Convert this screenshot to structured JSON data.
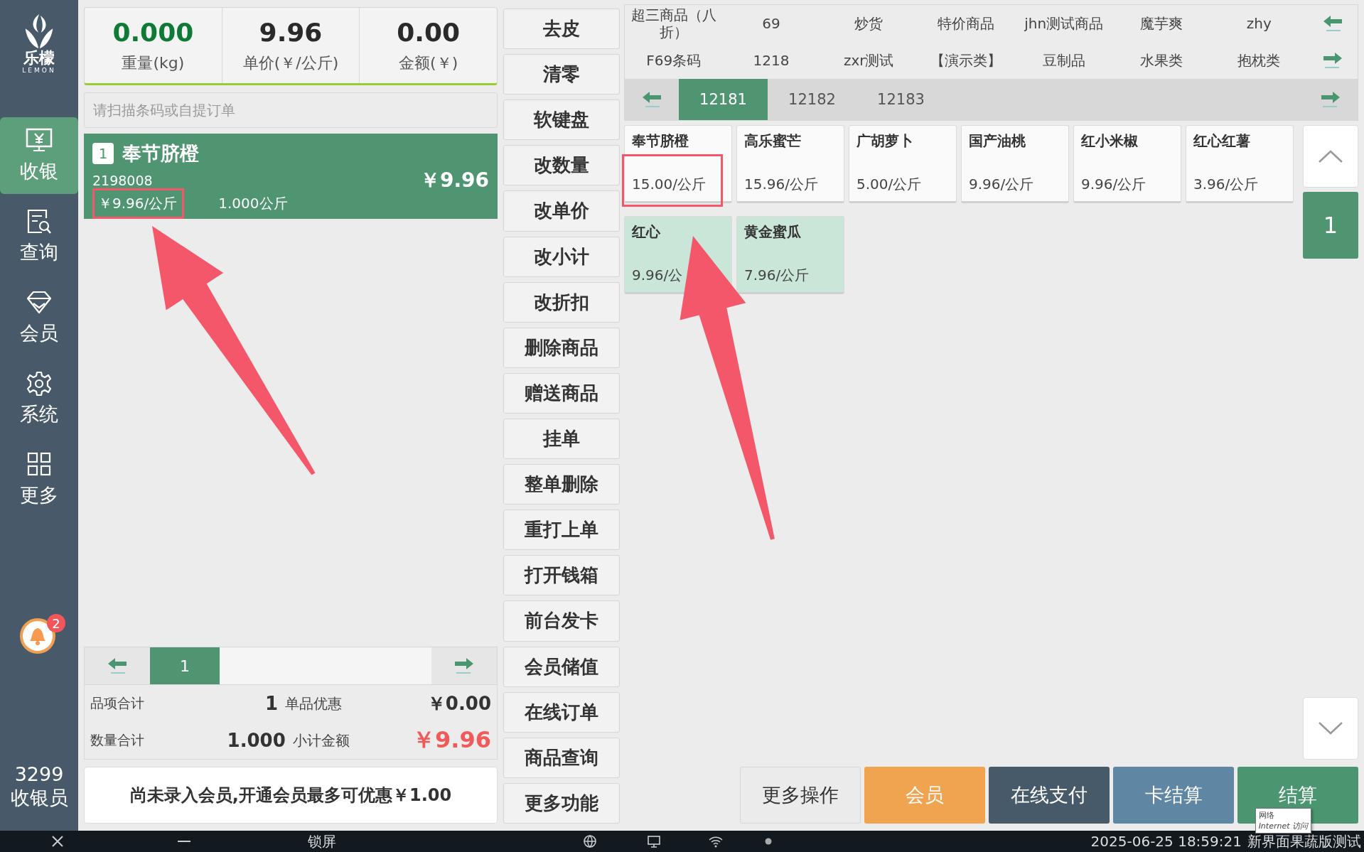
{
  "logo": {
    "name": "乐檬",
    "subtitle": "LEMON"
  },
  "nav": [
    {
      "label": "收银",
      "selected": true
    },
    {
      "label": "查询",
      "selected": false
    },
    {
      "label": "会员",
      "selected": false
    },
    {
      "label": "系统",
      "selected": false
    },
    {
      "label": "更多",
      "selected": false
    }
  ],
  "notifications": {
    "count": "2"
  },
  "operator": {
    "id": "3299",
    "role": "收银员"
  },
  "scale": [
    {
      "value": "0.000",
      "label": "重量(kg)",
      "kind": "weight"
    },
    {
      "value": "9.96",
      "label": "单价(￥/公斤)",
      "kind": "plain"
    },
    {
      "value": "0.00",
      "label": "金额(￥)",
      "kind": "plain"
    }
  ],
  "scan_field": {
    "placeholder": "请扫描条码或自提订单"
  },
  "order_items": [
    {
      "index": "1",
      "name": "奉节脐橙",
      "code": "2198008",
      "amount": "￥9.96",
      "unit_price": "￥9.96/公斤",
      "quantity": "1.000公斤",
      "selected": true,
      "highlighted": true
    }
  ],
  "order_pages": {
    "pages": [
      {
        "label": "1",
        "selected": true
      }
    ]
  },
  "totals": [
    {
      "label": "品项合计",
      "value": "1",
      "label2": "单品优惠",
      "value2": "￥0.00",
      "kind": "plain"
    },
    {
      "label": "数量合计",
      "value": "1.000",
      "label2": "小计金额",
      "value2": "￥9.96",
      "kind": "total"
    }
  ],
  "member_banner": "尚未录入会员,开通会员最多可优惠￥1.00",
  "functions": [
    "去皮",
    "清零",
    "软键盘",
    "改数量",
    "改单价",
    "改小计",
    "改折扣",
    "删除商品",
    "赠送商品",
    "挂单",
    "整单删除",
    "重打上单",
    "打开钱箱",
    "前台发卡",
    "会员储值",
    "在线订单",
    "商品查询",
    "更多功能"
  ],
  "categories": [
    [
      "超三商品（八折）",
      "69",
      "炒货",
      "特价商品",
      "jhn测试商品",
      "魔芋爽",
      "zhy"
    ],
    [
      "F69条码",
      "1218",
      "zxr测试",
      "【演示类】",
      "豆制品",
      "水果类",
      "抱枕类"
    ]
  ],
  "subcategories": [
    {
      "label": "12181",
      "selected": true
    },
    {
      "label": "12182",
      "selected": false
    },
    {
      "label": "12183",
      "selected": false
    }
  ],
  "products": [
    {
      "name": "奉节脐橙",
      "price": "15.00/公斤",
      "highlighted": false,
      "annotated": true
    },
    {
      "name": "高乐蜜芒",
      "price": "15.96/公斤",
      "highlighted": false,
      "annotated": false
    },
    {
      "name": "广胡萝卜",
      "price": "5.00/公斤",
      "highlighted": false,
      "annotated": false
    },
    {
      "name": "国产油桃",
      "price": "9.96/公斤",
      "highlighted": false,
      "annotated": false
    },
    {
      "name": "红小米椒",
      "price": "9.96/公斤",
      "highlighted": false,
      "annotated": false
    },
    {
      "name": "红心红薯",
      "price": "3.96/公斤",
      "highlighted": false,
      "annotated": false
    },
    {
      "name": "红心",
      "price": "9.96/公",
      "highlighted": true,
      "annotated": false
    },
    {
      "name": "黄金蜜瓜",
      "price": "7.96/公斤",
      "highlighted": true,
      "annotated": false
    }
  ],
  "product_page": "1",
  "actions": [
    {
      "label": "更多操作",
      "kind": "more"
    },
    {
      "label": "会员",
      "kind": "member"
    },
    {
      "label": "在线支付",
      "kind": "online"
    },
    {
      "label": "卡结算",
      "kind": "card"
    },
    {
      "label": "结算",
      "kind": "checkout"
    }
  ],
  "tooltip": {
    "title": "网络",
    "text": "Internet 访问"
  },
  "annotations": [
    {
      "kind": "arrow"
    },
    {
      "kind": "arrow"
    }
  ],
  "taskbar": {
    "lock": "锁屏",
    "datetime": "2025-06-25 18:59:21",
    "store": "新界面果蔬版测试"
  }
}
